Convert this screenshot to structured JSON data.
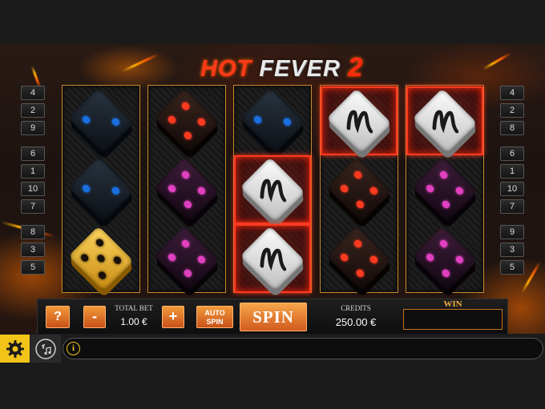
{
  "logo": {
    "hot": "HOT",
    "fever": "FEVER",
    "two": "2"
  },
  "paylines_left": [
    "4",
    "2",
    "9",
    "6",
    "1",
    "10",
    "7",
    "8",
    "3",
    "5"
  ],
  "paylines_right": [
    "4",
    "2",
    "8",
    "6",
    "1",
    "10",
    "7",
    "9",
    "3",
    "5"
  ],
  "reels": [
    [
      "blue-die",
      "blue-die",
      "gold-die"
    ],
    [
      "red-die",
      "pink-die",
      "pink-die"
    ],
    [
      "blue-die",
      "white-wild-die",
      "white-wild-die"
    ],
    [
      "white-wild-die",
      "red-die",
      "red-die"
    ],
    [
      "white-wild-die",
      "pink-die",
      "pink-die"
    ]
  ],
  "winning_cells": [
    [
      2,
      1
    ],
    [
      2,
      2
    ],
    [
      3,
      0
    ],
    [
      4,
      0
    ]
  ],
  "controls": {
    "help_label": "?",
    "minus_label": "-",
    "total_bet_label": "TOTAL BET",
    "total_bet_value": "1.00 €",
    "plus_label": "+",
    "auto_spin_line1": "AUTO",
    "auto_spin_line2": "SPIN",
    "spin_label": "SPIN",
    "credits_label": "CREDITS",
    "credits_value": "250.00 €",
    "win_label": "WIN"
  },
  "bottombar": {
    "settings_icon": "gear-icon",
    "sound_icon": "sound-fx-music-icon",
    "info_icon": "info-icon",
    "info_glyph": "i"
  },
  "colors": {
    "accent_orange": "#e07a2a",
    "win_red": "#ff3a20",
    "settings_yellow": "#f2c418",
    "blue_die": "#1a6fe0",
    "red_die": "#ff3a20",
    "pink_die": "#e040c0",
    "gold_die": "#e8a820"
  }
}
